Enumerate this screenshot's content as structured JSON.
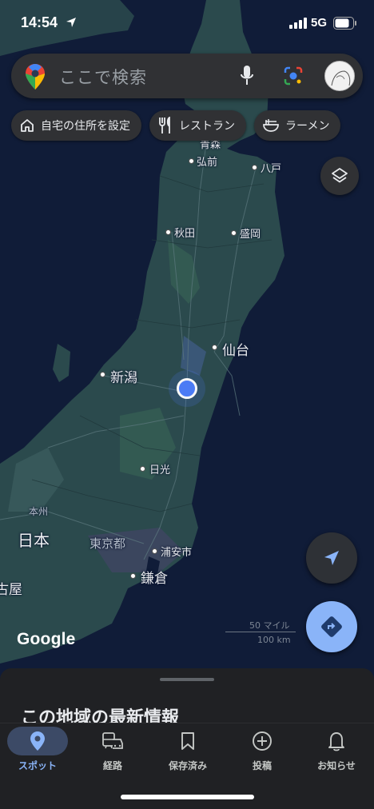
{
  "status_bar": {
    "time": "14:54",
    "network": "5G"
  },
  "search": {
    "placeholder": "ここで検索"
  },
  "chips": [
    {
      "icon": "home-icon",
      "label": "自宅の住所を設定"
    },
    {
      "icon": "restaurant-icon",
      "label": "レストラン"
    },
    {
      "icon": "ramen-icon",
      "label": "ラーメン"
    }
  ],
  "map": {
    "places": {
      "aomori": "青森",
      "hirosaki": "弘前",
      "hachinohe": "八戸",
      "akita": "秋田",
      "morioka": "盛岡",
      "sendai": "仙台",
      "niigata": "新潟",
      "nikko": "日光",
      "honshu": "本州",
      "nihon": "日本",
      "tokyo": "東京都",
      "urayasu": "浦安市",
      "kamakura": "鎌倉",
      "nagoya_partial": "古屋"
    },
    "scale": {
      "miles": "50 マイル",
      "km": "100 km"
    },
    "attribution": "Google"
  },
  "sheet": {
    "title": "この地域の最新情報"
  },
  "nav": [
    {
      "icon": "location-pin-icon",
      "label": "スポット",
      "active": true
    },
    {
      "icon": "commute-icon",
      "label": "経路",
      "active": false
    },
    {
      "icon": "bookmark-icon",
      "label": "保存済み",
      "active": false
    },
    {
      "icon": "add-circle-icon",
      "label": "投稿",
      "active": false
    },
    {
      "icon": "bell-icon",
      "label": "お知らせ",
      "active": false
    }
  ],
  "colors": {
    "ocean": "#101c38",
    "land": "#2b4a4d",
    "accent": "#8ab4f8",
    "location_dot": "#4b7bf5"
  }
}
